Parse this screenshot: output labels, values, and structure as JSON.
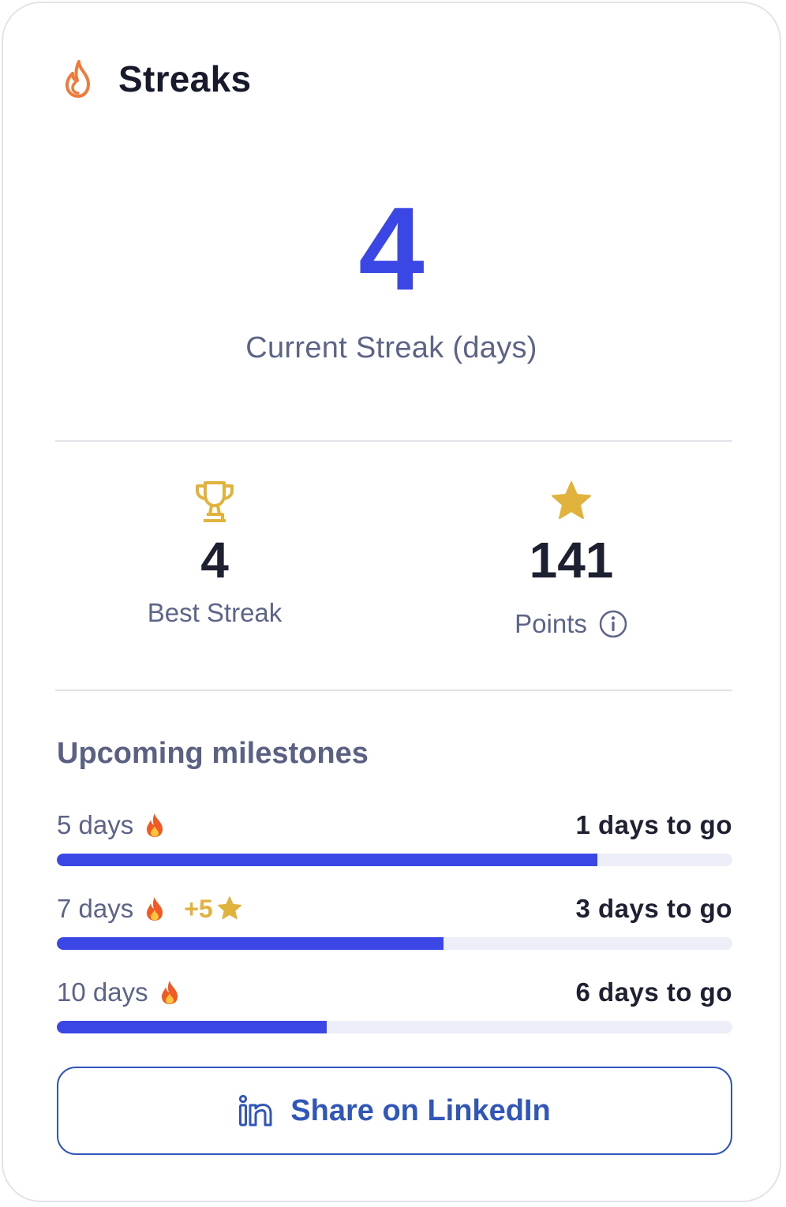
{
  "header": {
    "title": "Streaks",
    "icon": "flame-icon"
  },
  "current_streak": {
    "value": "4",
    "label": "Current Streak (days)"
  },
  "stats": {
    "best_streak": {
      "value": "4",
      "label": "Best Streak",
      "icon": "trophy-icon"
    },
    "points": {
      "value": "141",
      "label": "Points",
      "icon": "star-icon",
      "info_icon": "info-icon"
    }
  },
  "milestones": {
    "title": "Upcoming milestones",
    "items": [
      {
        "label": "5 days",
        "bonus": "",
        "remaining": "1 days to go",
        "progress": 0.8
      },
      {
        "label": "7 days",
        "bonus": "+5",
        "remaining": "3 days to go",
        "progress": 0.572
      },
      {
        "label": "10 days",
        "bonus": "",
        "remaining": "6 days to go",
        "progress": 0.4
      }
    ]
  },
  "share_button": {
    "label": "Share on LinkedIn",
    "icon": "linkedin-icon"
  },
  "colors": {
    "accent": "#3a47e5",
    "flame": "#ef7a3a",
    "gold": "#e2b33c",
    "linkedin": "#2f56b8",
    "muted_text": "#5c6488",
    "border": "#e3e4ea"
  }
}
